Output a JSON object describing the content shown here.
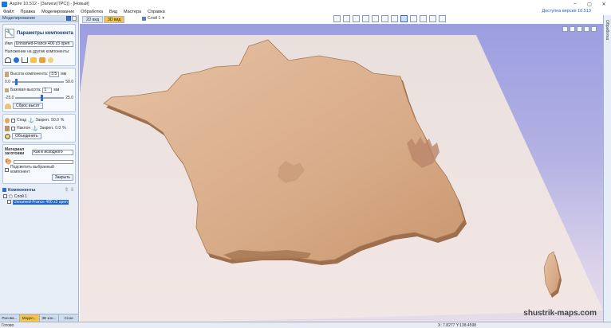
{
  "window": {
    "title": "Aspire 10.512 - [Записи(ТРС)] - [Новый]",
    "controls": [
      "–",
      "▢",
      "✕"
    ]
  },
  "menu": {
    "items": [
      "Файл",
      "Правка",
      "Моделирование",
      "Обработка",
      "Вид",
      "Мастера",
      "Справка"
    ],
    "version_link": "Доступна версия 10.513"
  },
  "left_panel": {
    "header": "Моделирование",
    "params_title": "Параметры компонента",
    "name_label": "Имя",
    "name_value": "Unnamed-France 400 z3 open",
    "overlay_label": "Наложение на другие компоненты:",
    "height_label": "Высота компонента:",
    "height_value": "3.5",
    "height_unit": "мм",
    "height_min": "0.0",
    "height_max": "50.0",
    "base_label": "Базовая высота:",
    "base_value": "1",
    "base_unit": "мм",
    "base_min": "-25.0",
    "base_max": "25.0",
    "reset_height": "Сброс высот",
    "fade_label": "Спад",
    "fade_lock": "Закреп.",
    "fade_value": "50.0",
    "fade_unit": "%",
    "tilt_label": "Наклон",
    "tilt_lock": "Закреп.",
    "tilt_value": "0.0",
    "tilt_unit": "%",
    "combine_btn": "Объединить",
    "material_label": "Материал заготовки",
    "material_value": "Как в исходного",
    "highlight_label": "Подсветить выбранный компонент",
    "close_btn": "Закрыть"
  },
  "components": {
    "header": "Компоненты",
    "layer": "Слой 1",
    "item": "Unnamed-France 400 z3 open"
  },
  "bottom_tabs": [
    "Рисова...",
    "Модел...",
    "3D кон...",
    "Слои"
  ],
  "view": {
    "tab_2d": "2D вид",
    "tab_3d": "3D вид",
    "layer_select": "Слой 1"
  },
  "right_strip_label": "Обработка",
  "watermark": "shustrik-maps.com",
  "status": {
    "ready": "Готово",
    "coords": "X: 7.8277 Y:138.4598"
  },
  "colors": {
    "accent": "#2a6ed3",
    "active_tab": "#f4c44a",
    "relief": "#dcb08f"
  }
}
